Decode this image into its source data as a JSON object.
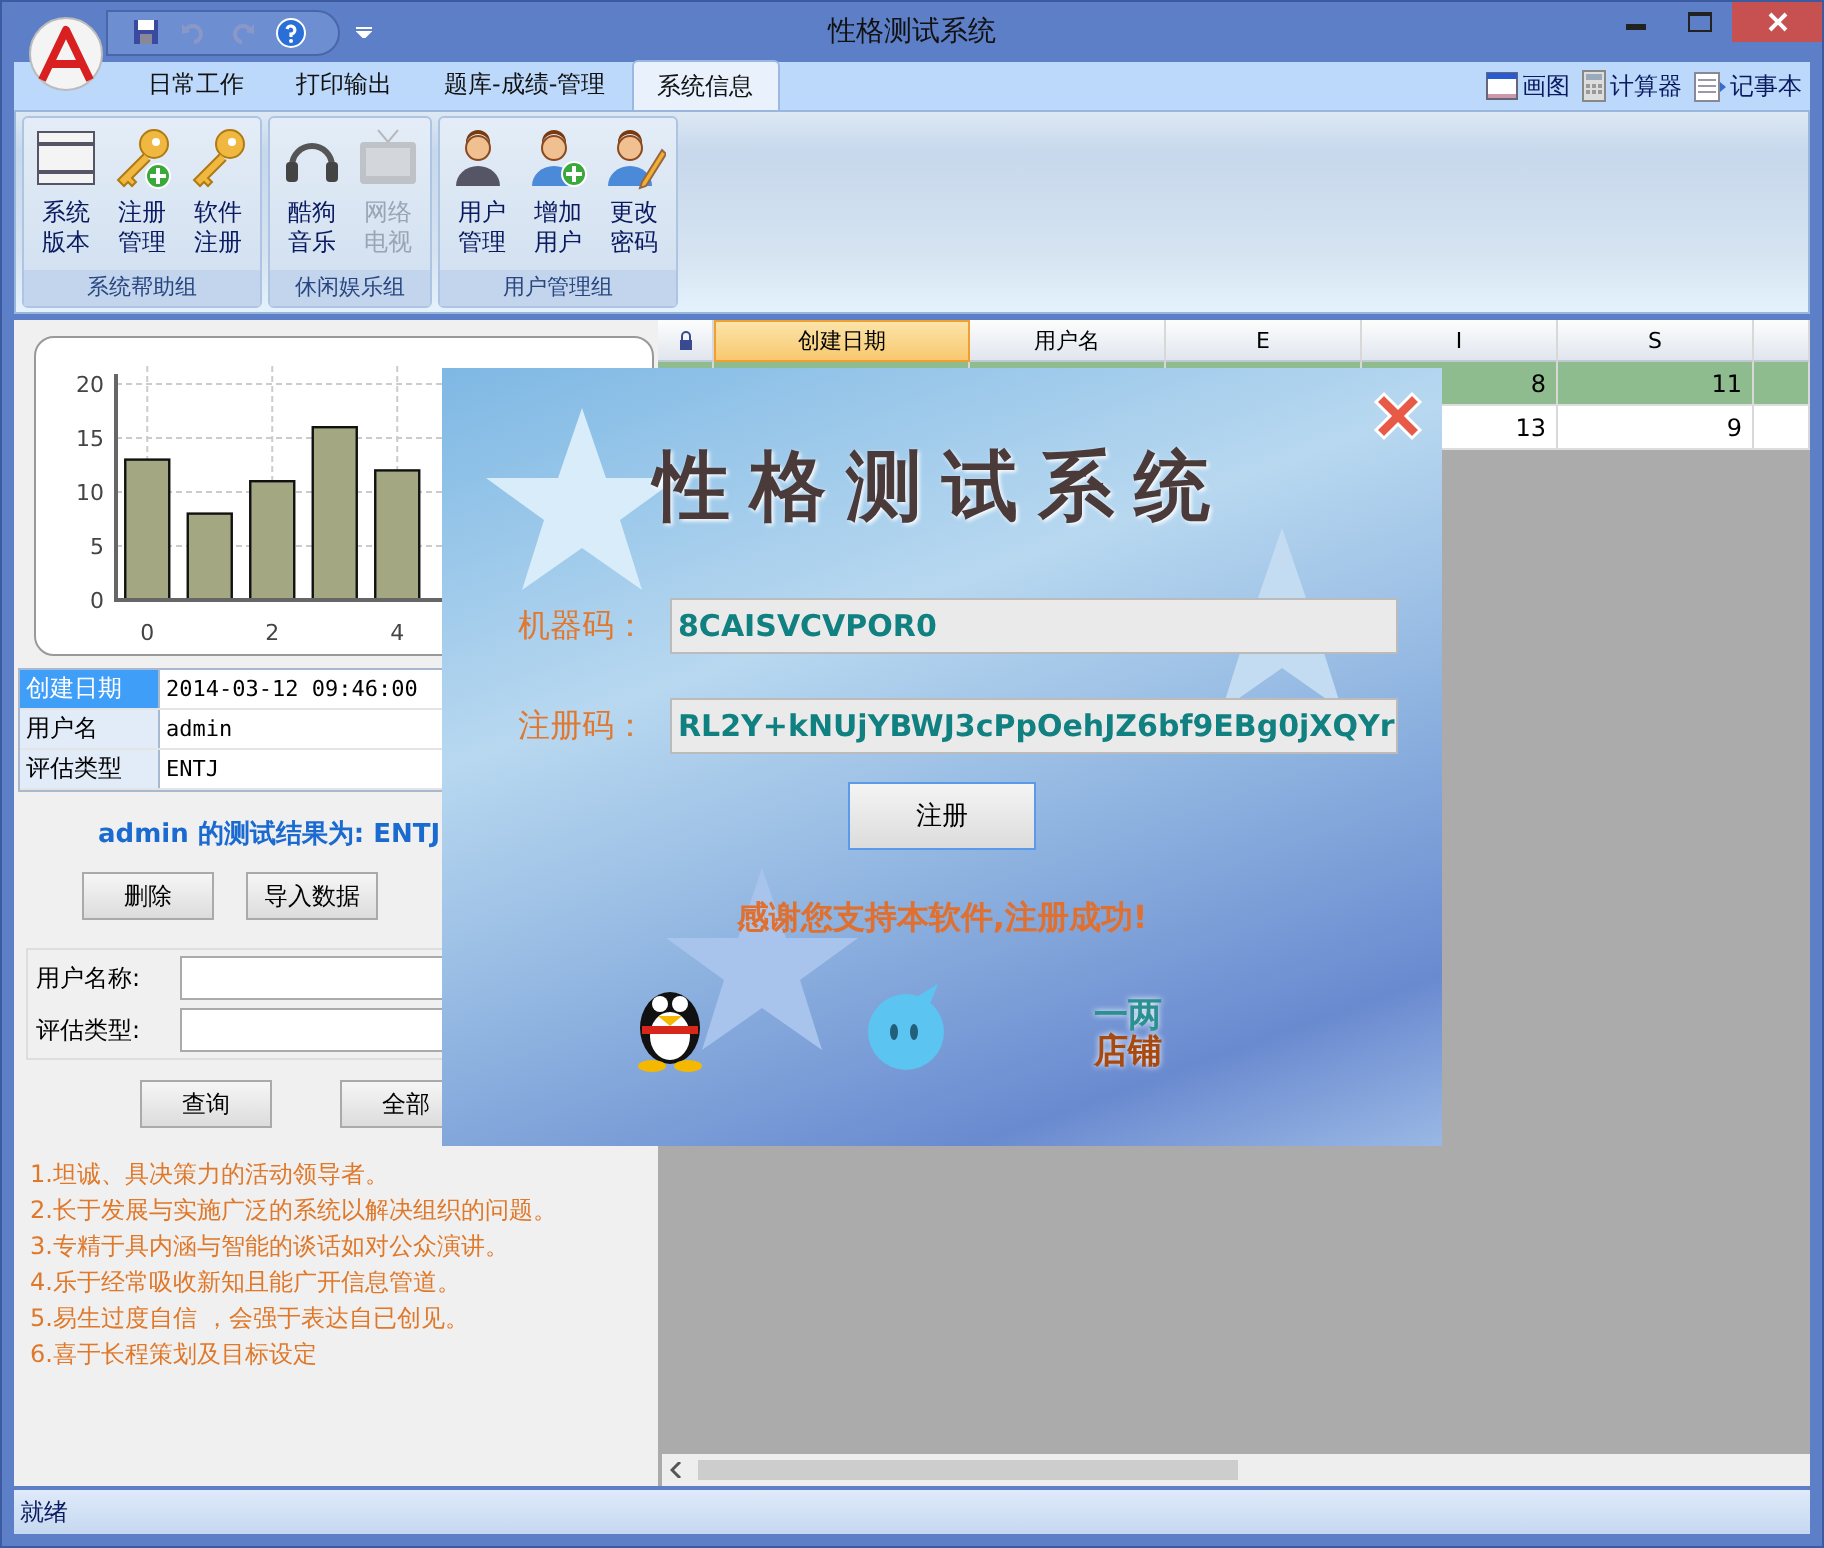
{
  "window": {
    "title": "性格测试系统"
  },
  "ribbon_tabs": [
    {
      "label": "日常工作",
      "selected": false
    },
    {
      "label": "打印输出",
      "selected": false
    },
    {
      "label": "题库-成绩-管理",
      "selected": false
    },
    {
      "label": "系统信息",
      "selected": true
    }
  ],
  "tools": [
    "画图",
    "计算器",
    "记事本"
  ],
  "ribbon_groups": [
    {
      "title": "系统帮助组",
      "items": [
        {
          "label": "系统版本",
          "disabled": false
        },
        {
          "label": "注册管理",
          "disabled": false
        },
        {
          "label": "软件注册",
          "disabled": false
        }
      ]
    },
    {
      "title": "休闲娱乐组",
      "items": [
        {
          "label": "酷狗音乐",
          "disabled": false
        },
        {
          "label": "网络电视",
          "disabled": true
        }
      ]
    },
    {
      "title": "用户管理组",
      "items": [
        {
          "label": "用户管理",
          "disabled": false
        },
        {
          "label": "增加用户",
          "disabled": false
        },
        {
          "label": "更改密码",
          "disabled": false
        }
      ]
    }
  ],
  "chart_data": {
    "type": "bar",
    "x": [
      0,
      1,
      2,
      3,
      4
    ],
    "values": [
      13,
      8,
      11,
      16,
      12
    ],
    "xlim": [
      -0.5,
      7.5
    ],
    "ylim": [
      0,
      20
    ],
    "yticks": [
      0,
      5,
      10,
      15,
      20
    ],
    "xticks": [
      0,
      2,
      4
    ],
    "grid": true
  },
  "details": [
    {
      "label": "创建日期",
      "value": "2014-03-12 09:46:00",
      "selected": true
    },
    {
      "label": "用户名",
      "value": "admin",
      "selected": false
    },
    {
      "label": "评估类型",
      "value": "ENTJ",
      "selected": false
    }
  ],
  "result_text": "admin 的测试结果为: ENTJ",
  "action_buttons": [
    "删除",
    "导入数据"
  ],
  "search_fields": [
    {
      "label": "用户名称:"
    },
    {
      "label": "评估类型:"
    }
  ],
  "search_buttons": [
    "查询",
    "全部"
  ],
  "traits": [
    "1.坦诚、具决策力的活动领导者。",
    "2.长于发展与实施广泛的系统以解决组织的问题。",
    "3.专精于具内涵与智能的谈话如对公众演讲。",
    "4.乐于经常吸收新知且能广开信息管道。",
    "5.易生过度自信 ，会强于表达自已创见。",
    "6.喜于长程策划及目标设定"
  ],
  "grid": {
    "columns": [
      {
        "label": "创建日期",
        "selected": true
      },
      {
        "label": "用户名",
        "selected": false
      },
      {
        "label": "E",
        "selected": false
      },
      {
        "label": "I",
        "selected": false
      },
      {
        "label": "S",
        "selected": false
      }
    ],
    "rows": [
      {
        "selected": true,
        "I": "8",
        "S": "11"
      },
      {
        "selected": false,
        "I": "13",
        "S": "9"
      }
    ]
  },
  "dialog": {
    "title": "性格测试系统",
    "machine_label": "机器码：",
    "machine_code": "8CAISVCVPOR0",
    "reg_label": "注册码：",
    "reg_code": "RL2Y+kNUjYBWJ3cPpOehJZ6bf9EBg0jXQYr",
    "button": "注册",
    "message": "感谢您支持本软件,注册成功!",
    "shop_logo": [
      "一两",
      "店铺"
    ]
  },
  "status_bar": "就绪"
}
